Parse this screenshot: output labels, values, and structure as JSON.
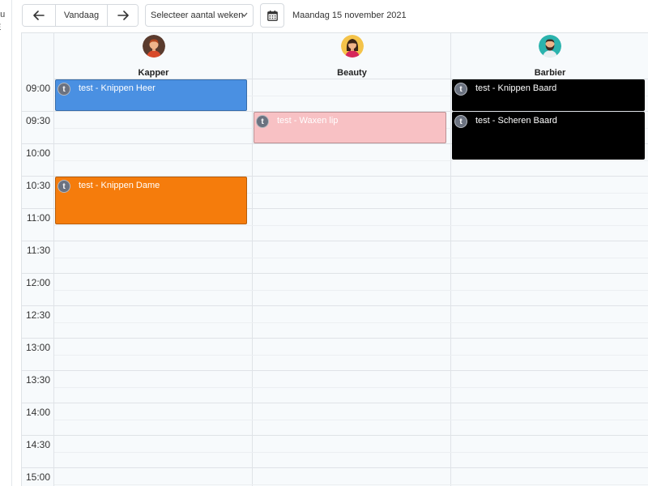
{
  "sidebar": {
    "fragments": [
      "nu",
      "E"
    ]
  },
  "toolbar": {
    "prev_icon": "arrow-left-icon",
    "today_label": "Vandaag",
    "next_icon": "arrow-right-icon",
    "weeks_select": {
      "label": "Selecteer aantal weken",
      "icon": "chevron-down-icon"
    },
    "calendar_icon": "calendar-icon",
    "date_label": "Maandag 15 november 2021"
  },
  "calendar": {
    "time_labels": [
      "09:00",
      "09:30",
      "10:00",
      "10:30",
      "11:00",
      "11:30",
      "12:00",
      "12:30",
      "13:00",
      "13:30",
      "14:00",
      "14:30",
      "15:00"
    ],
    "resources": [
      {
        "name": "Kapper",
        "avatar": "man-avatar-icon",
        "avatar_color": "#b5552c"
      },
      {
        "name": "Beauty",
        "avatar": "woman-avatar-icon",
        "avatar_color": "#f4c34a"
      },
      {
        "name": "Barbier",
        "avatar": "bearded-man-avatar-icon",
        "avatar_color": "#2bb3ad"
      }
    ],
    "events": [
      {
        "resource": "Kapper",
        "badge": "t",
        "title": "test - Knippen Heer",
        "start": "09:00",
        "end": "09:30",
        "color": "#4a90e2",
        "text_color": "#ffffff"
      },
      {
        "resource": "Kapper",
        "badge": "t",
        "title": "test - Knippen Dame",
        "start": "10:30",
        "end": "11:15",
        "color": "#f57c0c",
        "text_color": "#ffffff"
      },
      {
        "resource": "Beauty",
        "badge": "t",
        "title": "test - Waxen lip",
        "start": "09:30",
        "end": "10:00",
        "color": "#f8c1c4",
        "text_color": "#ffffff"
      },
      {
        "resource": "Barbier",
        "badge": "t",
        "title": "test - Knippen Baard",
        "start": "09:00",
        "end": "09:30",
        "color": "#000000",
        "text_color": "#ffffff"
      },
      {
        "resource": "Barbier",
        "badge": "t",
        "title": "test - Scheren Baard",
        "start": "09:30",
        "end": "10:15",
        "color": "#000000",
        "text_color": "#ffffff"
      }
    ]
  },
  "colors": {
    "grid_background": "#f7fafc",
    "grid_line": "#dfe3e7",
    "badge": "#6b7280"
  }
}
